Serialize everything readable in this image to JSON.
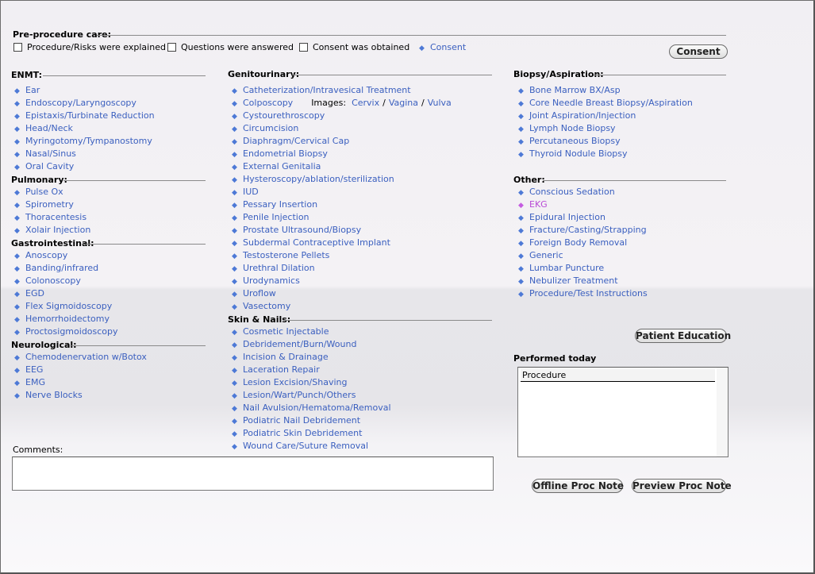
{
  "preprocedure": {
    "heading": "Pre-procedure care:",
    "checkboxes": [
      {
        "label": "Procedure/Risks were explained"
      },
      {
        "label": "Questions were answered"
      },
      {
        "label": "Consent was obtained"
      }
    ],
    "consent_link": "Consent",
    "consent_button": "Consent"
  },
  "enmt": {
    "heading": "ENMT:",
    "items": [
      "Ear",
      "Endoscopy/Laryngoscopy",
      "Epistaxis/Turbinate Reduction",
      "Head/Neck",
      "Myringotomy/Tympanostomy",
      "Nasal/Sinus",
      "Oral Cavity"
    ]
  },
  "pulmonary": {
    "heading": "Pulmonary:",
    "items": [
      "Pulse Ox",
      "Spirometry",
      "Thoracentesis",
      "Xolair Injection"
    ]
  },
  "gastro": {
    "heading": "Gastrointestinal:",
    "items": [
      "Anoscopy",
      "Banding/infrared",
      "Colonoscopy",
      "EGD",
      "Flex Sigmoidoscopy",
      "Hemorrhoidectomy",
      "Proctosigmoidoscopy"
    ]
  },
  "neuro": {
    "heading": "Neurological:",
    "items": [
      "Chemodenervation w/Botox",
      "EEG",
      "EMG",
      "Nerve Blocks"
    ]
  },
  "genito": {
    "heading": "Genitourinary:",
    "first_item": "Catheterization/Intravesical Treatment",
    "colposcopy": "Colposcopy",
    "images_label": "Images:",
    "images": [
      "Cervix",
      "Vagina",
      "Vulva"
    ],
    "items": [
      "Cystourethroscopy",
      "Circumcision",
      "Diaphragm/Cervical Cap",
      "Endometrial Biopsy",
      "External Genitalia",
      "Hysteroscopy/ablation/sterilization",
      "IUD",
      "Pessary Insertion",
      "Penile Injection",
      "Prostate Ultrasound/Biopsy",
      "Subdermal Contraceptive Implant",
      "Testosterone Pellets",
      "Urethral Dilation",
      "Urodynamics",
      "Uroflow",
      "Vasectomy"
    ]
  },
  "skin": {
    "heading": "Skin & Nails:",
    "items": [
      "Cosmetic Injectable",
      "Debridement/Burn/Wound",
      "Incision & Drainage",
      "Laceration Repair",
      "Lesion Excision/Shaving",
      "Lesion/Wart/Punch/Others",
      "Nail Avulsion/Hematoma/Removal",
      "Podiatric Nail Debridement",
      "Podiatric Skin Debridement",
      "Wound Care/Suture Removal"
    ]
  },
  "biopsy": {
    "heading": "Biopsy/Aspiration:",
    "items": [
      "Bone Marrow BX/Asp",
      "Core Needle Breast Biopsy/Aspiration",
      "Joint Aspiration/Injection",
      "Lymph Node Biopsy",
      "Percutaneous Biopsy",
      "Thyroid Nodule Biopsy"
    ]
  },
  "other": {
    "heading": "Other:",
    "items": [
      "Conscious Sedation",
      "EKG",
      "Epidural Injection",
      "Fracture/Casting/Strapping",
      "Foreign Body Removal",
      "Generic",
      "Lumbar Puncture",
      "Nebulizer Treatment",
      "Procedure/Test Instructions"
    ],
    "active_index": 1
  },
  "patient_education_button": "Patient Education",
  "performed_today": {
    "heading": "Performed today",
    "column_header": "Procedure"
  },
  "comments": {
    "label": "Comments:",
    "value": ""
  },
  "offline_button": "Offline Proc Note",
  "preview_button": "Preview Proc Note",
  "colors": {
    "link": "#3a5fbf",
    "active_link": "#b84ad6",
    "bullet": "#4d79d6"
  },
  "icons": {
    "bullet": "diamond-bullet-icon"
  }
}
